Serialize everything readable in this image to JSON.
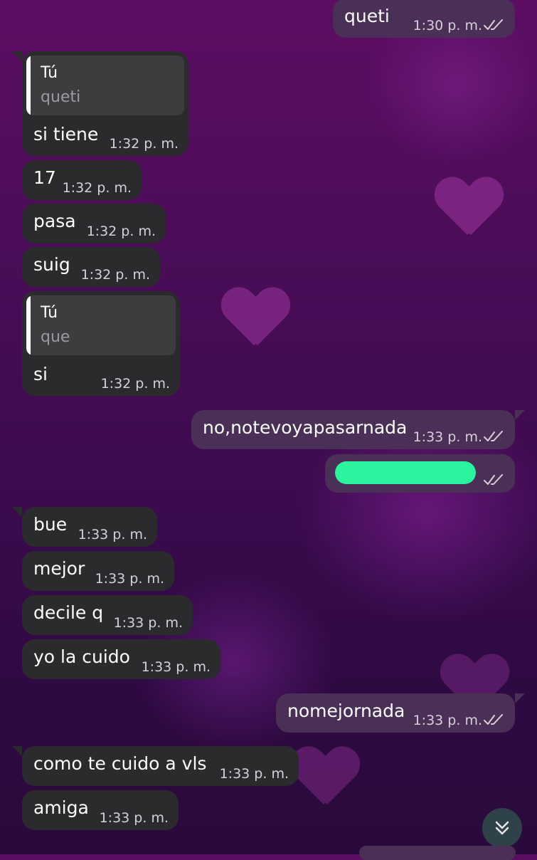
{
  "messages": [
    {
      "direction": "out",
      "text": "queti",
      "time": "1:30 p. m."
    },
    {
      "direction": "in",
      "reply_author": "Tú",
      "reply_text": "queti",
      "text": "si tiene",
      "time": "1:32 p. m."
    },
    {
      "direction": "in",
      "text": "17",
      "time": "1:32 p. m."
    },
    {
      "direction": "in",
      "text": "pasa",
      "time": "1:32 p. m."
    },
    {
      "direction": "in",
      "text": "suig",
      "time": "1:32 p. m."
    },
    {
      "direction": "in",
      "reply_author": "Tú",
      "reply_text": "que",
      "text": "si",
      "time": "1:32 p. m."
    },
    {
      "direction": "out",
      "text": "no,notevoyapasarnada",
      "time": "1:33 p. m."
    },
    {
      "direction": "out",
      "text": "",
      "redacted": true,
      "time": ""
    },
    {
      "direction": "in",
      "text": "bue",
      "time": "1:33 p. m."
    },
    {
      "direction": "in",
      "text": "mejor",
      "time": "1:33 p. m."
    },
    {
      "direction": "in",
      "text": "decile q",
      "time": "1:33 p. m."
    },
    {
      "direction": "in",
      "text": "yo la cuido",
      "time": "1:33 p. m."
    },
    {
      "direction": "out",
      "text": "nomejornada",
      "time": "1:33 p. m."
    },
    {
      "direction": "in",
      "text": "como te cuido a vls",
      "time": "1:33 p. m."
    },
    {
      "direction": "in",
      "text": "amiga",
      "time": "1:33 p. m."
    }
  ],
  "icons": {
    "read_receipt": "double-check-icon",
    "scroll_down": "double-chevron-down-icon"
  },
  "colors": {
    "incoming_bubble": "#2b2b2e",
    "outgoing_bubble": "#4a2f56",
    "redaction": "#2af59e"
  }
}
